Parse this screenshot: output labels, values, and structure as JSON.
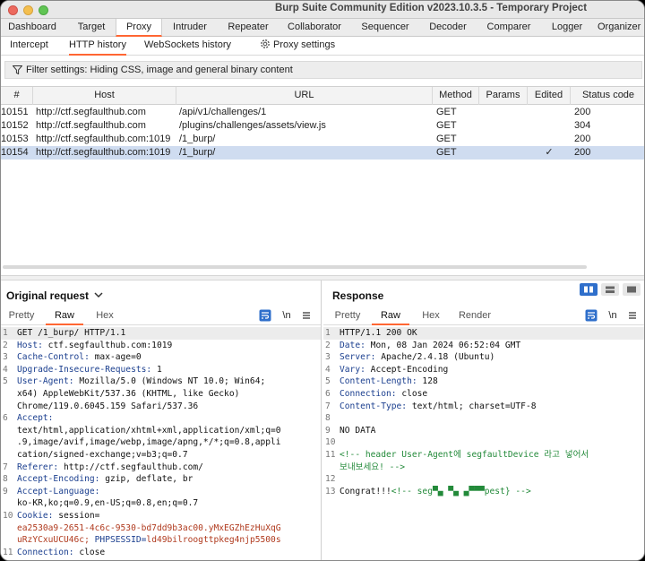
{
  "window": {
    "title": "Burp Suite Community Edition v2023.10.3.5 - Temporary Project"
  },
  "top_tabs": [
    "Dashboard",
    "Target",
    "Proxy",
    "Intruder",
    "Repeater",
    "Collaborator",
    "Sequencer",
    "Decoder",
    "Comparer",
    "Logger",
    "Organizer"
  ],
  "active_top_tab": "Proxy",
  "sub_tabs": [
    "Intercept",
    "HTTP history",
    "WebSockets history"
  ],
  "active_sub_tab": "HTTP history",
  "proxy_settings_label": "Proxy settings",
  "filter_text": "Filter settings: Hiding CSS, image and general binary content",
  "history_table": {
    "columns": [
      "#",
      "Host",
      "URL",
      "Method",
      "Params",
      "Edited",
      "Status code"
    ],
    "rows": [
      {
        "id": "10151",
        "host": "http://ctf.segfaulthub.com",
        "url": "/api/v1/challenges/1",
        "method": "GET",
        "params": "",
        "edited": "",
        "status": "200"
      },
      {
        "id": "10152",
        "host": "http://ctf.segfaulthub.com",
        "url": "/plugins/challenges/assets/view.js",
        "method": "GET",
        "params": "",
        "edited": "",
        "status": "304"
      },
      {
        "id": "10153",
        "host": "http://ctf.segfaulthub.com:1019",
        "url": "/1_burp/",
        "method": "GET",
        "params": "",
        "edited": "",
        "status": "200"
      },
      {
        "id": "10154",
        "host": "http://ctf.segfaulthub.com:1019",
        "url": "/1_burp/",
        "method": "GET",
        "params": "",
        "edited": "✓",
        "status": "200"
      }
    ],
    "selected_row": "10154"
  },
  "request_pane": {
    "title": "Original request",
    "tabs": [
      "Pretty",
      "Raw",
      "Hex"
    ],
    "active_tab": "Raw",
    "newline_label": "\\n",
    "lines": [
      {
        "n": "1",
        "k": "",
        "v": "GET /1_burp/ HTTP/1.1"
      },
      {
        "n": "2",
        "k": "Host:",
        "v": " ctf.segfaulthub.com:1019"
      },
      {
        "n": "3",
        "k": "Cache-Control:",
        "v": " max-age=0"
      },
      {
        "n": "4",
        "k": "Upgrade-Insecure-Requests:",
        "v": " 1"
      },
      {
        "n": "5",
        "k": "User-Agent:",
        "v": " Mozilla/5.0 (Windows NT 10.0; Win64;"
      },
      {
        "n": "",
        "k": "",
        "v": "x64) AppleWebKit/537.36 (KHTML, like Gecko)"
      },
      {
        "n": "",
        "k": "",
        "v": "Chrome/119.0.6045.159 Safari/537.36"
      },
      {
        "n": "6",
        "k": "Accept:",
        "v": ""
      },
      {
        "n": "",
        "k": "",
        "v": "text/html,application/xhtml+xml,application/xml;q=0"
      },
      {
        "n": "",
        "k": "",
        "v": ".9,image/avif,image/webp,image/apng,*/*;q=0.8,appli"
      },
      {
        "n": "",
        "k": "",
        "v": "cation/signed-exchange;v=b3;q=0.7"
      },
      {
        "n": "7",
        "k": "Referer:",
        "v": " http://ctf.segfaulthub.com/"
      },
      {
        "n": "8",
        "k": "Accept-Encoding:",
        "v": " gzip, deflate, br"
      },
      {
        "n": "9",
        "k": "Accept-Language:",
        "v": ""
      },
      {
        "n": "",
        "k": "",
        "v": "ko-KR,ko;q=0.9,en-US;q=0.8,en;q=0.7"
      },
      {
        "n": "10",
        "k": "Cookie:",
        "v": " session="
      },
      {
        "n": "",
        "k": "",
        "c": "ea2530a9-2651-4c6c-9530-bd7dd9b3ac00.yMxEGZhEzHuXqG"
      },
      {
        "n": "",
        "k": "",
        "c": "uRzYCxuUCU46c;",
        "k2": " PHPSESSID=",
        "c2": "ld49bilroogttpkeg4njp5500s"
      },
      {
        "n": "11",
        "k": "Connection:",
        "v": " close"
      }
    ]
  },
  "response_pane": {
    "title": "Response",
    "tabs": [
      "Pretty",
      "Raw",
      "Hex",
      "Render"
    ],
    "active_tab": "Raw",
    "newline_label": "\\n",
    "lines": [
      {
        "n": "1",
        "k": "",
        "v": "HTTP/1.1 200 OK"
      },
      {
        "n": "2",
        "k": "Date:",
        "v": " Mon, 08 Jan 2024 06:52:04 GMT"
      },
      {
        "n": "3",
        "k": "Server:",
        "v": " Apache/2.4.18 (Ubuntu)"
      },
      {
        "n": "4",
        "k": "Vary:",
        "v": " Accept-Encoding"
      },
      {
        "n": "5",
        "k": "Content-Length:",
        "v": " 128"
      },
      {
        "n": "6",
        "k": "Connection:",
        "v": " close"
      },
      {
        "n": "7",
        "k": "Content-Type:",
        "v": " text/html; charset=UTF-8"
      },
      {
        "n": "8",
        "k": "",
        "v": ""
      },
      {
        "n": "9",
        "k": "",
        "v": "NO DATA"
      },
      {
        "n": "10",
        "k": "",
        "v": ""
      },
      {
        "n": "11",
        "k": "",
        "m": "<!-- header User-Agent에 segfaultDevice 라고 넣어서"
      },
      {
        "n": "",
        "k": "",
        "m": "보내보세요! -->"
      },
      {
        "n": "12",
        "k": "",
        "v": ""
      },
      {
        "n": "13",
        "k": "",
        "v": "Congrat!!!",
        "m": "<!-- seg▀▄  ▀▄ ▄▀▀▀pest} -->"
      }
    ]
  }
}
